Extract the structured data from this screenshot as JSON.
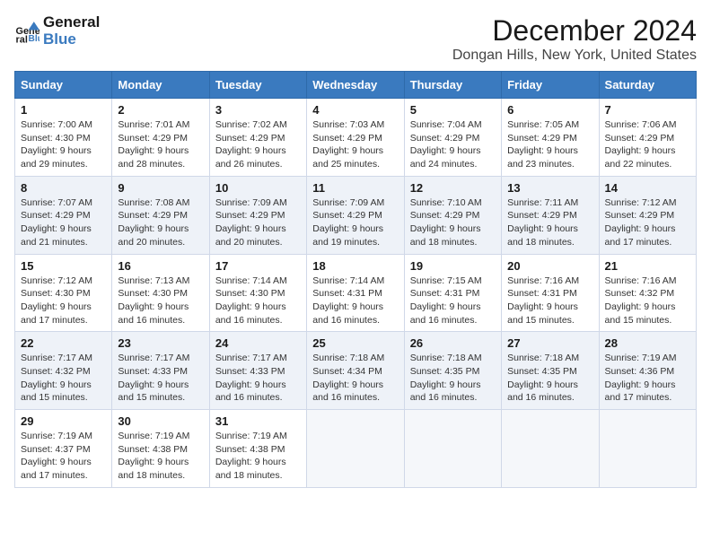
{
  "logo": {
    "line1": "General",
    "line2": "Blue"
  },
  "title": "December 2024",
  "location": "Dongan Hills, New York, United States",
  "weekdays": [
    "Sunday",
    "Monday",
    "Tuesday",
    "Wednesday",
    "Thursday",
    "Friday",
    "Saturday"
  ],
  "weeks": [
    [
      {
        "day": "1",
        "sunrise": "7:00 AM",
        "sunset": "4:30 PM",
        "daylight": "9 hours and 29 minutes."
      },
      {
        "day": "2",
        "sunrise": "7:01 AM",
        "sunset": "4:29 PM",
        "daylight": "9 hours and 28 minutes."
      },
      {
        "day": "3",
        "sunrise": "7:02 AM",
        "sunset": "4:29 PM",
        "daylight": "9 hours and 26 minutes."
      },
      {
        "day": "4",
        "sunrise": "7:03 AM",
        "sunset": "4:29 PM",
        "daylight": "9 hours and 25 minutes."
      },
      {
        "day": "5",
        "sunrise": "7:04 AM",
        "sunset": "4:29 PM",
        "daylight": "9 hours and 24 minutes."
      },
      {
        "day": "6",
        "sunrise": "7:05 AM",
        "sunset": "4:29 PM",
        "daylight": "9 hours and 23 minutes."
      },
      {
        "day": "7",
        "sunrise": "7:06 AM",
        "sunset": "4:29 PM",
        "daylight": "9 hours and 22 minutes."
      }
    ],
    [
      {
        "day": "8",
        "sunrise": "7:07 AM",
        "sunset": "4:29 PM",
        "daylight": "9 hours and 21 minutes."
      },
      {
        "day": "9",
        "sunrise": "7:08 AM",
        "sunset": "4:29 PM",
        "daylight": "9 hours and 20 minutes."
      },
      {
        "day": "10",
        "sunrise": "7:09 AM",
        "sunset": "4:29 PM",
        "daylight": "9 hours and 20 minutes."
      },
      {
        "day": "11",
        "sunrise": "7:09 AM",
        "sunset": "4:29 PM",
        "daylight": "9 hours and 19 minutes."
      },
      {
        "day": "12",
        "sunrise": "7:10 AM",
        "sunset": "4:29 PM",
        "daylight": "9 hours and 18 minutes."
      },
      {
        "day": "13",
        "sunrise": "7:11 AM",
        "sunset": "4:29 PM",
        "daylight": "9 hours and 18 minutes."
      },
      {
        "day": "14",
        "sunrise": "7:12 AM",
        "sunset": "4:29 PM",
        "daylight": "9 hours and 17 minutes."
      }
    ],
    [
      {
        "day": "15",
        "sunrise": "7:12 AM",
        "sunset": "4:30 PM",
        "daylight": "9 hours and 17 minutes."
      },
      {
        "day": "16",
        "sunrise": "7:13 AM",
        "sunset": "4:30 PM",
        "daylight": "9 hours and 16 minutes."
      },
      {
        "day": "17",
        "sunrise": "7:14 AM",
        "sunset": "4:30 PM",
        "daylight": "9 hours and 16 minutes."
      },
      {
        "day": "18",
        "sunrise": "7:14 AM",
        "sunset": "4:31 PM",
        "daylight": "9 hours and 16 minutes."
      },
      {
        "day": "19",
        "sunrise": "7:15 AM",
        "sunset": "4:31 PM",
        "daylight": "9 hours and 16 minutes."
      },
      {
        "day": "20",
        "sunrise": "7:16 AM",
        "sunset": "4:31 PM",
        "daylight": "9 hours and 15 minutes."
      },
      {
        "day": "21",
        "sunrise": "7:16 AM",
        "sunset": "4:32 PM",
        "daylight": "9 hours and 15 minutes."
      }
    ],
    [
      {
        "day": "22",
        "sunrise": "7:17 AM",
        "sunset": "4:32 PM",
        "daylight": "9 hours and 15 minutes."
      },
      {
        "day": "23",
        "sunrise": "7:17 AM",
        "sunset": "4:33 PM",
        "daylight": "9 hours and 15 minutes."
      },
      {
        "day": "24",
        "sunrise": "7:17 AM",
        "sunset": "4:33 PM",
        "daylight": "9 hours and 16 minutes."
      },
      {
        "day": "25",
        "sunrise": "7:18 AM",
        "sunset": "4:34 PM",
        "daylight": "9 hours and 16 minutes."
      },
      {
        "day": "26",
        "sunrise": "7:18 AM",
        "sunset": "4:35 PM",
        "daylight": "9 hours and 16 minutes."
      },
      {
        "day": "27",
        "sunrise": "7:18 AM",
        "sunset": "4:35 PM",
        "daylight": "9 hours and 16 minutes."
      },
      {
        "day": "28",
        "sunrise": "7:19 AM",
        "sunset": "4:36 PM",
        "daylight": "9 hours and 17 minutes."
      }
    ],
    [
      {
        "day": "29",
        "sunrise": "7:19 AM",
        "sunset": "4:37 PM",
        "daylight": "9 hours and 17 minutes."
      },
      {
        "day": "30",
        "sunrise": "7:19 AM",
        "sunset": "4:38 PM",
        "daylight": "9 hours and 18 minutes."
      },
      {
        "day": "31",
        "sunrise": "7:19 AM",
        "sunset": "4:38 PM",
        "daylight": "9 hours and 18 minutes."
      },
      null,
      null,
      null,
      null
    ]
  ]
}
